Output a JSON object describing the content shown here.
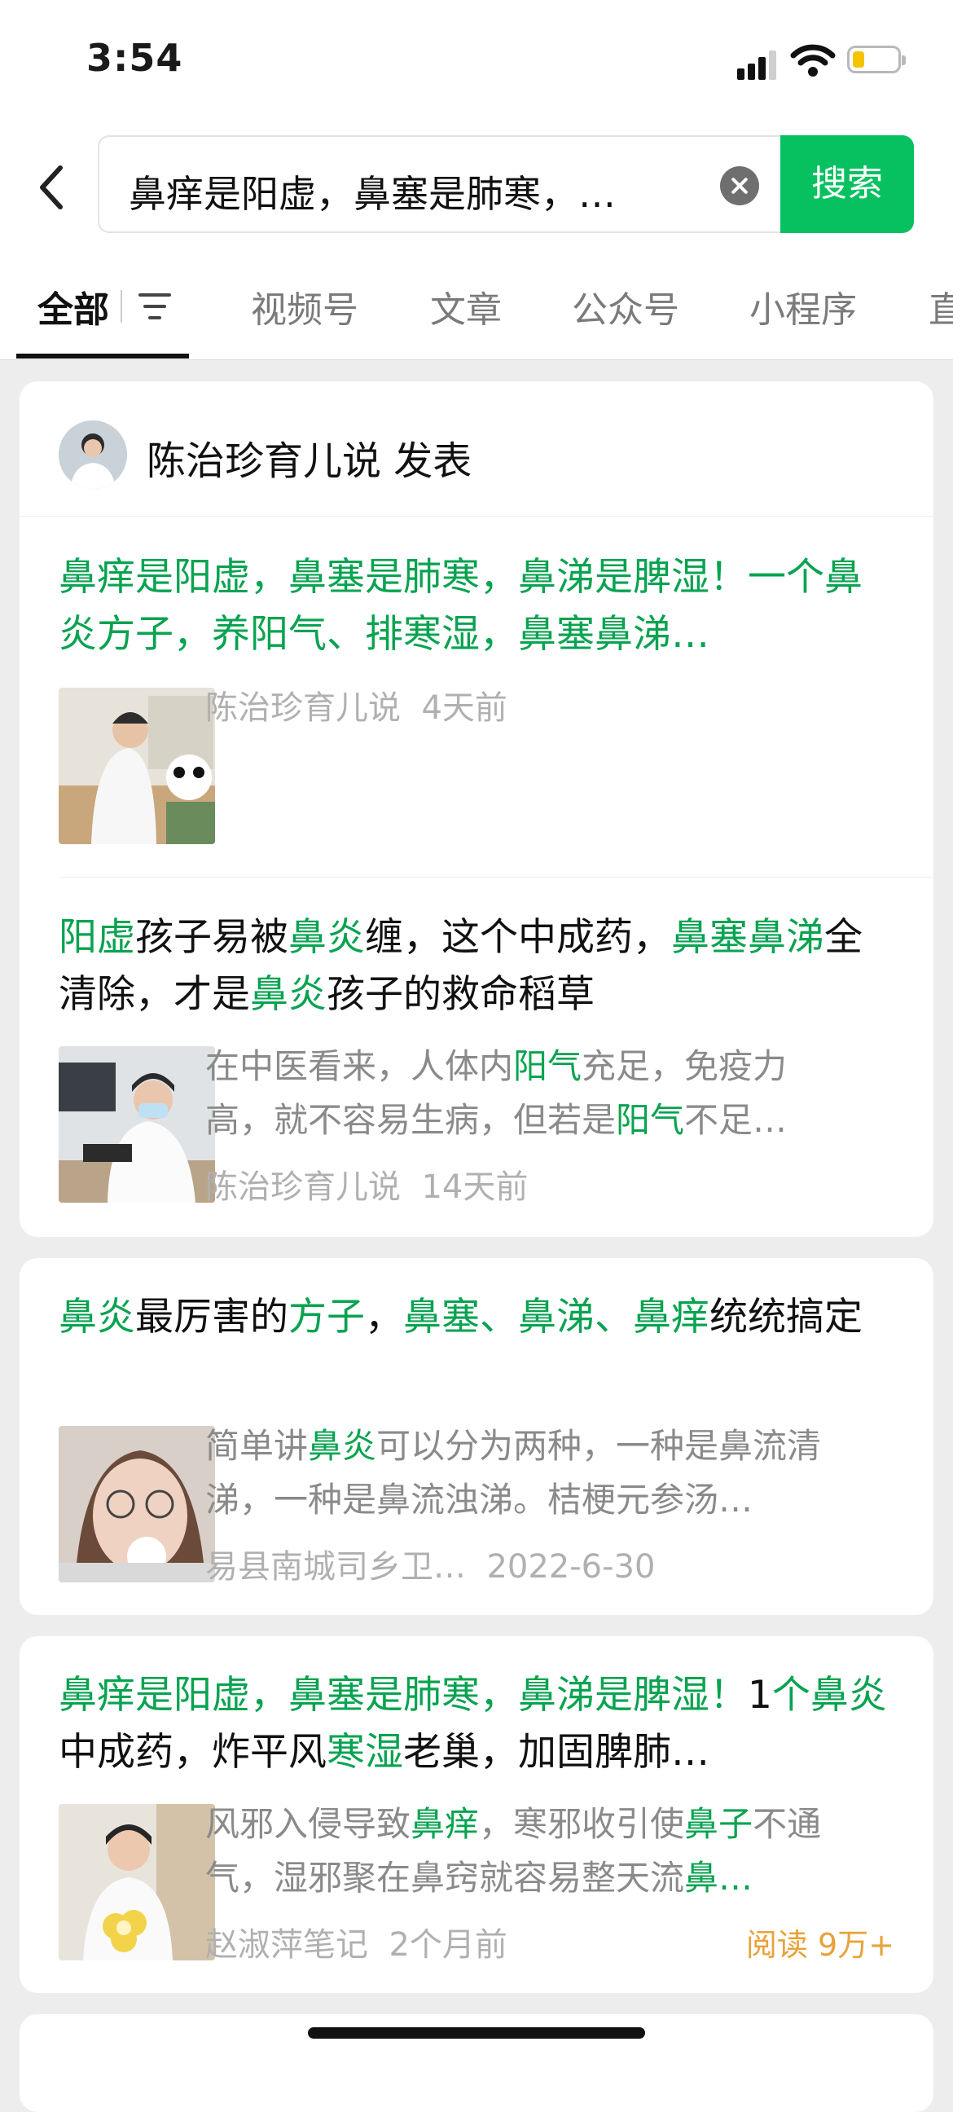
{
  "status": {
    "time": "3:54"
  },
  "search": {
    "query": "鼻痒是阳虚，鼻塞是肺寒，…",
    "button": "搜索"
  },
  "tabs": [
    {
      "label": "全部",
      "active": true
    },
    {
      "label": "视频号"
    },
    {
      "label": "文章"
    },
    {
      "label": "公众号"
    },
    {
      "label": "小程序"
    },
    {
      "label": "直"
    }
  ],
  "card1": {
    "author": "陈治珍育儿说 发表",
    "item1": {
      "title_segments": [
        {
          "t": "鼻痒是阳虚，鼻塞是肺寒，鼻涕是脾湿！一个鼻炎方子，养阳气、排寒湿，鼻塞鼻涕…",
          "hl": true
        }
      ],
      "source": "陈治珍育儿说",
      "time": "4天前"
    },
    "item2": {
      "title_segments": [
        {
          "t": "阳虚",
          "hl": true
        },
        {
          "t": "孩子易被",
          "hl": false
        },
        {
          "t": "鼻炎",
          "hl": true
        },
        {
          "t": "缠，这个中成药，",
          "hl": false
        },
        {
          "t": "鼻塞鼻涕",
          "hl": true
        },
        {
          "t": "全清除，才是",
          "hl": false
        },
        {
          "t": "鼻炎",
          "hl": true
        },
        {
          "t": "孩子的救命稻草",
          "hl": false
        }
      ],
      "desc_segments": [
        {
          "t": "在中医看来，人体内",
          "hl": false
        },
        {
          "t": "阳气",
          "hl": true
        },
        {
          "t": "充足，免疫力高，就不容易生病，但若是",
          "hl": false
        },
        {
          "t": "阳气",
          "hl": true
        },
        {
          "t": "不足…",
          "hl": false
        }
      ],
      "source": "陈治珍育儿说",
      "time": "14天前"
    }
  },
  "card2": {
    "title_segments": [
      {
        "t": "鼻炎",
        "hl": true
      },
      {
        "t": "最厉害的",
        "hl": false
      },
      {
        "t": "方子",
        "hl": true
      },
      {
        "t": "，",
        "hl": false
      },
      {
        "t": "鼻塞、鼻涕、鼻痒",
        "hl": true
      },
      {
        "t": "统统搞定",
        "hl": false
      }
    ],
    "desc_segments": [
      {
        "t": "简单讲",
        "hl": false
      },
      {
        "t": "鼻炎",
        "hl": true
      },
      {
        "t": "可以分为两种，一种是鼻流清涕，一种是鼻流浊涕。桔梗元参汤…",
        "hl": false
      }
    ],
    "source": "易县南城司乡卫…",
    "time": "2022-6-30"
  },
  "card3": {
    "title_segments": [
      {
        "t": "鼻痒是阳虚，鼻塞是肺寒，鼻涕是脾湿！",
        "hl": true
      },
      {
        "t": "1",
        "hl": false
      },
      {
        "t": "个鼻炎",
        "hl": true
      },
      {
        "t": "中成药，炸平风",
        "hl": false
      },
      {
        "t": "寒湿",
        "hl": true
      },
      {
        "t": "老巢，加固脾肺…",
        "hl": false
      }
    ],
    "desc_segments": [
      {
        "t": "风邪入侵导致",
        "hl": false
      },
      {
        "t": "鼻痒",
        "hl": true
      },
      {
        "t": "，寒邪收引使",
        "hl": false
      },
      {
        "t": "鼻子",
        "hl": true
      },
      {
        "t": "不通气，湿邪聚在鼻窍就容易整天流",
        "hl": false
      },
      {
        "t": "鼻…",
        "hl": true
      }
    ],
    "source": "赵淑萍笔记",
    "time": "2个月前",
    "reads": "阅读 9万+"
  },
  "colors": {
    "accent": "#07c160",
    "highlight": "#07a350",
    "reads": "#e8a23a"
  },
  "icons": [
    "back-arrow-icon",
    "clear-icon",
    "filter-icon",
    "signal-icon",
    "wifi-icon",
    "battery-icon"
  ]
}
